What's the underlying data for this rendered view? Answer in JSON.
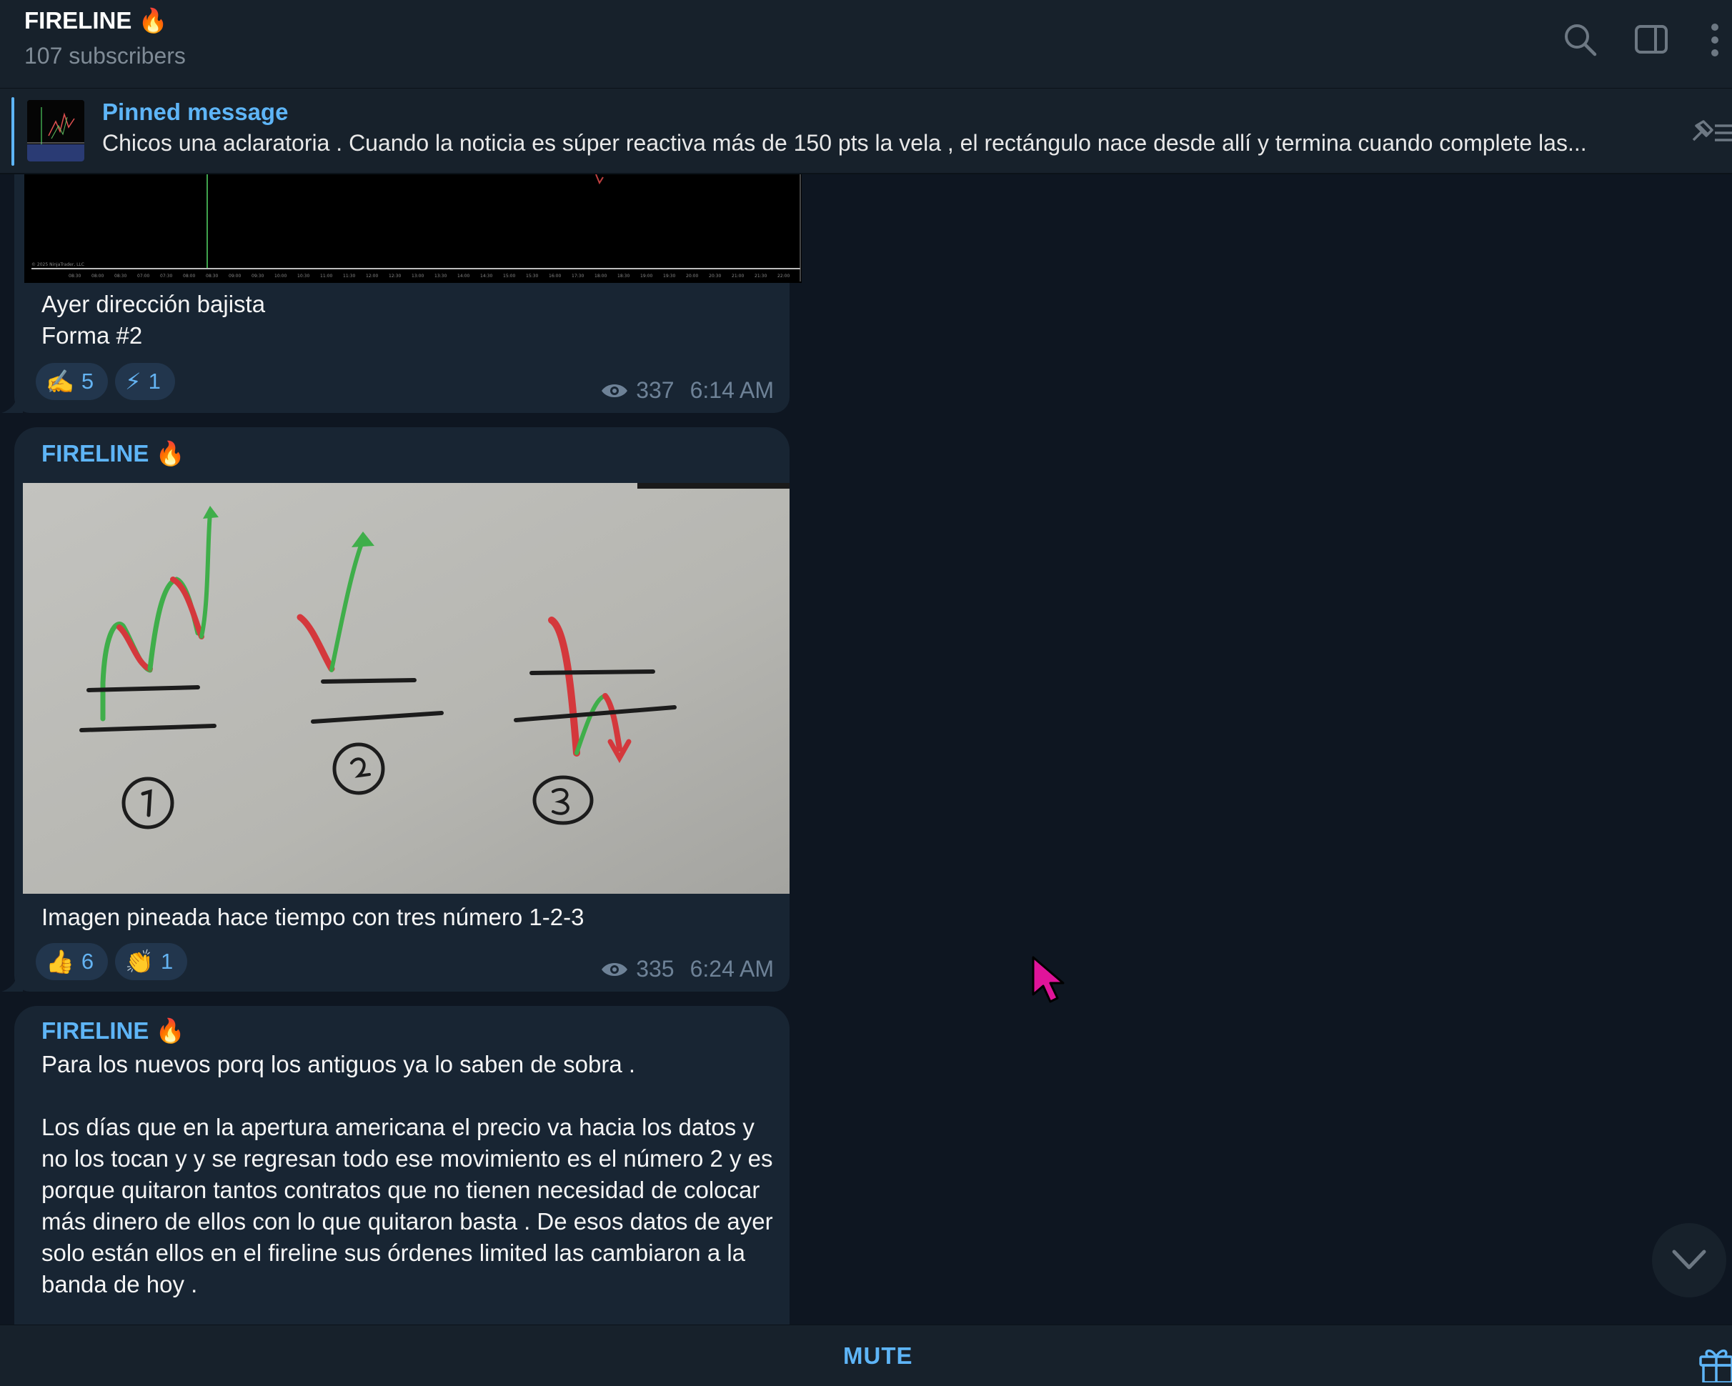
{
  "header": {
    "title": "FIRELINE 🔥",
    "subscribers": "107 subscribers"
  },
  "pinned": {
    "title": "Pinned message",
    "text": "Chicos una aclaratoria .  Cuando la noticia es súper reactiva más de 150 pts la vela , el rectángulo nace desde allí y termina cuando complete las..."
  },
  "messages": [
    {
      "caption_lines": [
        "Ayer dirección bajista",
        "Forma #2"
      ],
      "reactions": [
        {
          "emoji": "✍️",
          "count": "5"
        },
        {
          "emoji": "⚡",
          "count": "1"
        }
      ],
      "views": "337",
      "time": "6:14 AM"
    },
    {
      "sender": "FIRELINE 🔥",
      "caption": "Imagen pineada hace tiempo con tres número 1-2-3",
      "reactions": [
        {
          "emoji": "👍",
          "count": "6"
        },
        {
          "emoji": "👏",
          "count": "1"
        }
      ],
      "views": "335",
      "time": "6:24 AM"
    },
    {
      "sender": "FIRELINE 🔥",
      "paragraphs": [
        "Para los nuevos porq los antiguos ya lo saben de sobra .",
        "Los días que en la apertura americana el precio va hacia los datos y no los tocan y y se regresan todo ese movimiento es el número 2 y es porque quitaron tantos contratos que no tienen necesidad de colocar más dinero de ellos con lo que quitaron basta . De esos datos de ayer solo están ellos en el fireline sus órdenes limited las cambiaron a la banda de hoy ."
      ]
    }
  ],
  "bottom": {
    "mute_label": "MUTE"
  },
  "colors": {
    "background": "#0e1621",
    "panel": "#17212b",
    "bubble": "#182533",
    "accent": "#5eb5f7",
    "meta": "#6e8297",
    "cursor": "#e0149a"
  },
  "icons": [
    "search-icon",
    "sidebar-toggle-icon",
    "more-vertical-icon",
    "unpin-list-icon",
    "eye-icon",
    "chevron-down-icon",
    "gift-icon"
  ]
}
